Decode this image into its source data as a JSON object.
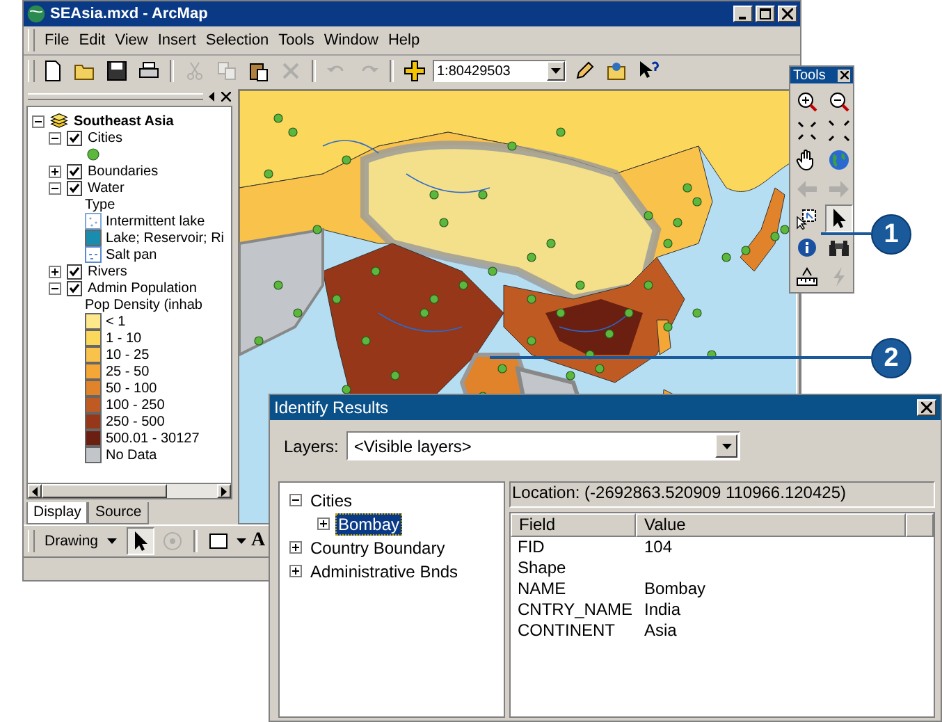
{
  "arcmap": {
    "title": "SEAsia.mxd - ArcMap",
    "menus": [
      "File",
      "Edit",
      "View",
      "Insert",
      "Selection",
      "Tools",
      "Window",
      "Help"
    ],
    "toolbar": [
      {
        "kind": "new",
        "disabled": false
      },
      {
        "kind": "open",
        "disabled": false
      },
      {
        "kind": "save",
        "disabled": false
      },
      {
        "kind": "print",
        "disabled": false
      },
      {
        "kind": "separator"
      },
      {
        "kind": "cut",
        "disabled": true
      },
      {
        "kind": "copy",
        "disabled": true
      },
      {
        "kind": "paste",
        "disabled": false
      },
      {
        "kind": "delete",
        "disabled": true
      },
      {
        "kind": "separator"
      },
      {
        "kind": "undo",
        "disabled": true
      },
      {
        "kind": "redo",
        "disabled": true
      },
      {
        "kind": "separator"
      },
      {
        "kind": "adddata",
        "disabled": false
      },
      {
        "kind": "scale",
        "value": "1:80429503"
      },
      {
        "kind": "editor",
        "disabled": false
      },
      {
        "kind": "catalog",
        "disabled": false
      },
      {
        "kind": "help",
        "disabled": false
      }
    ],
    "toc": {
      "items": [
        {
          "kind": "group",
          "label": "Southeast Asia",
          "expanded": true,
          "children": [
            {
              "kind": "layer",
              "label": "Cities",
              "checked": true,
              "expanded": true,
              "legend": {
                "entries": [
                  {
                    "kind": "dot",
                    "color": "#5cb83c"
                  }
                ]
              }
            },
            {
              "kind": "layer",
              "label": "Boundaries",
              "checked": true,
              "expanded": false
            },
            {
              "kind": "layer",
              "label": "Water",
              "checked": true,
              "expanded": true,
              "legend": {
                "heading": "Type",
                "entries": [
                  {
                    "kind": "dotted",
                    "label": "Intermittent lake",
                    "color": "#7fa8d8"
                  },
                  {
                    "kind": "solid",
                    "label": "Lake; Reservoir; Ri",
                    "color": "#1a8cae"
                  },
                  {
                    "kind": "hatch",
                    "label": "Salt pan",
                    "color": "#5a8ad0"
                  }
                ]
              }
            },
            {
              "kind": "layer",
              "label": "Rivers",
              "checked": true,
              "expanded": false
            },
            {
              "kind": "layer",
              "label": "Admin Population",
              "checked": true,
              "expanded": true,
              "legend": {
                "heading": "Pop Density (inhab",
                "entries": [
                  {
                    "kind": "solid",
                    "label": "< 1",
                    "color": "#fde98c"
                  },
                  {
                    "kind": "solid",
                    "label": "1 - 10",
                    "color": "#fbd75c"
                  },
                  {
                    "kind": "solid",
                    "label": "10 - 25",
                    "color": "#f9c24a"
                  },
                  {
                    "kind": "solid",
                    "label": "25 - 50",
                    "color": "#f4a636"
                  },
                  {
                    "kind": "solid",
                    "label": "50 - 100",
                    "color": "#e0832a"
                  },
                  {
                    "kind": "solid",
                    "label": "100 - 250",
                    "color": "#bf5b22"
                  },
                  {
                    "kind": "solid",
                    "label": "250 - 500",
                    "color": "#953718"
                  },
                  {
                    "kind": "solid",
                    "label": "500.01 - 30127",
                    "color": "#6a1f10"
                  },
                  {
                    "kind": "solid",
                    "label": "No Data",
                    "color": "#c2c6ca"
                  }
                ]
              }
            }
          ]
        }
      ]
    },
    "toc_tabs": [
      {
        "label": "Display",
        "selected": true
      },
      {
        "label": "Source",
        "selected": false
      }
    ],
    "drawing_toolbar": {
      "label": "Drawing",
      "tools": [
        {
          "kind": "pointer",
          "selected": true,
          "disabled": false
        },
        {
          "kind": "rotate",
          "selected": false,
          "disabled": true
        },
        {
          "kind": "rectangle",
          "selected": false,
          "disabled": false
        },
        {
          "kind": "text",
          "label": "A",
          "selected": false,
          "disabled": false
        }
      ]
    }
  },
  "tools_palette": {
    "title": "Tools",
    "tools": [
      {
        "kind": "zoomin",
        "selected": false,
        "disabled": false
      },
      {
        "kind": "zoomout",
        "selected": false,
        "disabled": false
      },
      {
        "kind": "fixedin",
        "selected": false,
        "disabled": false
      },
      {
        "kind": "fixedout",
        "selected": false,
        "disabled": false
      },
      {
        "kind": "pan",
        "selected": false,
        "disabled": false
      },
      {
        "kind": "globe",
        "selected": false,
        "disabled": false
      },
      {
        "kind": "back",
        "selected": false,
        "disabled": true
      },
      {
        "kind": "forward",
        "selected": false,
        "disabled": true
      },
      {
        "kind": "selectelements",
        "selected": false,
        "disabled": false
      },
      {
        "kind": "pointer",
        "selected": true,
        "disabled": false
      },
      {
        "kind": "identify",
        "selected": false,
        "disabled": false
      },
      {
        "kind": "find",
        "selected": false,
        "disabled": false
      },
      {
        "kind": "measure",
        "selected": false,
        "disabled": false
      },
      {
        "kind": "hyperlink",
        "selected": false,
        "disabled": true
      }
    ]
  },
  "identify": {
    "title": "Identify Results",
    "layers_label": "Layers:",
    "layers_value": "<Visible layers>",
    "tree": [
      {
        "label": "Cities",
        "expanded": true,
        "selected": false,
        "children": [
          {
            "label": "Bombay",
            "expanded": false,
            "selected": true
          }
        ]
      },
      {
        "label": "Country Boundary",
        "expanded": false,
        "selected": false
      },
      {
        "label": "Administrative Bnds",
        "expanded": false,
        "selected": false
      }
    ],
    "location": "Location: (-2692863.520909  110966.120425)",
    "columns": [
      "Field",
      "Value"
    ],
    "rows": [
      {
        "field": "FID",
        "value": "104"
      },
      {
        "field": "Shape"
      },
      {
        "field": "NAME",
        "value": "Bombay"
      },
      {
        "field": "CNTRY_NAME",
        "value": "India"
      },
      {
        "field": "CONTINENT",
        "value": "Asia"
      }
    ]
  },
  "callouts": [
    {
      "number": "1"
    },
    {
      "number": "2"
    }
  ]
}
